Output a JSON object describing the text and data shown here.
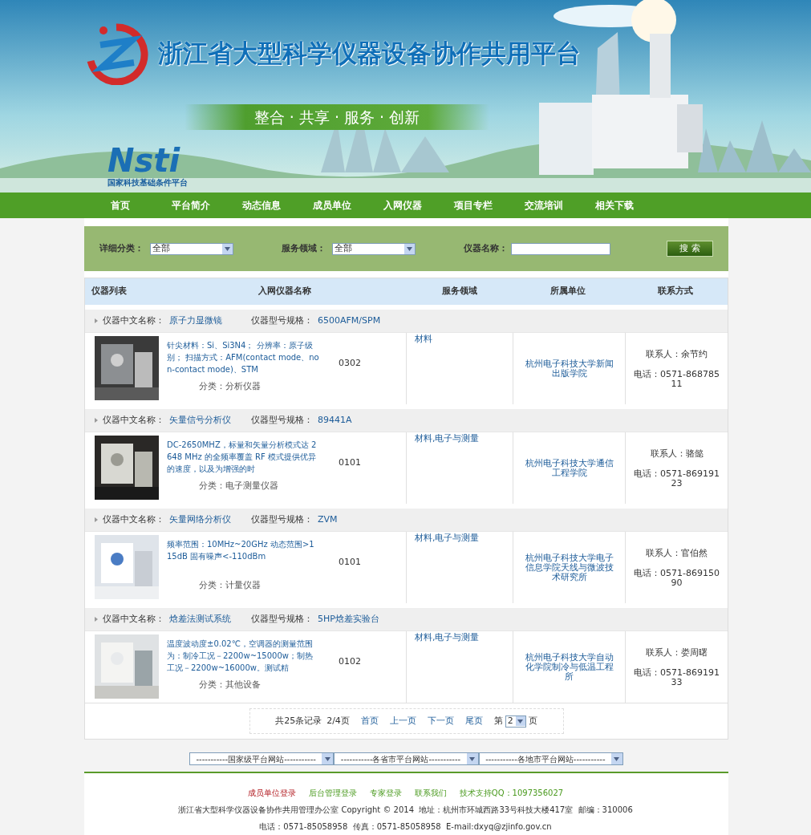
{
  "header": {
    "title": "浙江省大型科学仪器设备协作共用平台",
    "slogan": "整合 · 共享 · 服务 · 创新",
    "partner_mark": "Nsti",
    "partner_caption": "国家科技基础条件平台"
  },
  "nav": [
    "首页",
    "平台简介",
    "动态信息",
    "成员单位",
    "入网仪器",
    "项目专栏",
    "交流培训",
    "相关下载"
  ],
  "filters": [
    {
      "kind": "select",
      "label": "详细分类：",
      "value": "全部"
    },
    {
      "kind": "select",
      "label": "服务领域：",
      "value": "全部"
    },
    {
      "kind": "text",
      "label": "仪器名称："
    }
  ],
  "search_button": "搜 索",
  "table": {
    "columns": [
      "仪器列表",
      "入网仪器名称",
      "服务领域",
      "所属单位",
      "联系方式"
    ],
    "items": [
      {
        "name_label": "仪器中文名称：",
        "name": "原子力显微镜",
        "model_label": "仪器型号规格：",
        "model": "6500AFM/SPM",
        "description": "针尖材料：Si、Si3N4； 分辨率：原子级别； 扫描方式：AFM(contact mode、non-contact mode)、STM",
        "code": "0302",
        "category": "分类：分析仪器",
        "service": "材料",
        "unit": "杭州电子科技大学新闻出版学院",
        "contact": "联系人：余节约",
        "phone": "电话：0571-86878511"
      },
      {
        "name_label": "仪器中文名称：",
        "name": "矢量信号分析仪",
        "model_label": "仪器型号规格：",
        "model": "89441A",
        "description": "DC-2650MHZ，标量和矢量分析模式达 2648 MHz 的全频率覆盖 RF 模式提供优异的速度，以及为增强的时",
        "code": "0101",
        "category": "分类：电子测量仪器",
        "service": "材料,电子与测量",
        "unit": "杭州电子科技大学通信工程学院",
        "contact": "联系人：骆懿",
        "phone": "电话：0571-86919123"
      },
      {
        "name_label": "仪器中文名称：",
        "name": "矢量网络分析仪",
        "model_label": "仪器型号规格：",
        "model": "ZVM",
        "description": "频率范围：10MHz~20GHz 动态范围>115dB 固有噪声<-110dBm",
        "code": "0101",
        "category": "分类：计量仪器",
        "service": "材料,电子与测量",
        "unit": "杭州电子科技大学电子信息学院天线与微波技术研究所",
        "contact": "联系人：官伯然",
        "phone": "电话：0571-86915090"
      },
      {
        "name_label": "仪器中文名称：",
        "name": "焓差法测试系统",
        "model_label": "仪器型号规格：",
        "model": "5HP焓差实验台",
        "description": "温度波动度±0.02℃，空调器的测量范围为：制冷工况－2200w~15000w；制热工况－2200w~16000w。测试精",
        "code": "0102",
        "category": "分类：其他设备",
        "service": "材料,电子与测量",
        "unit": "杭州电子科技大学自动化学院制冷与低温工程所",
        "contact": "联系人：娄周曙",
        "phone": "电话：0571-86919133"
      }
    ]
  },
  "pagination": {
    "summary": "共25条记录",
    "pages": "2/4页",
    "links": [
      "首页",
      "上一页",
      "下一页",
      "尾页"
    ],
    "page_prefix": "第",
    "page_value": "2",
    "page_suffix": "页"
  },
  "site_selects": [
    "-----------国家级平台网站-----------",
    "-----------各省市平台网站-----------",
    "-----------各地市平台网站-----------"
  ],
  "footer": {
    "links": [
      {
        "text": "成员单位登录",
        "kind": "primary"
      },
      {
        "text": "后台管理登录",
        "kind": "link"
      },
      {
        "text": "专家登录",
        "kind": "link"
      },
      {
        "text": "联系我们",
        "kind": "link"
      },
      {
        "text": "技术支持QQ：1097356027",
        "kind": "link"
      }
    ],
    "lines": [
      "浙江省大型科学仪器设备协作共用管理办公室 Copyright © 2014  地址：杭州市环城西路33号科技大楼417室  邮编：310006",
      "电话：0571-85058958  传真：0571-85058958  E-mail:dxyq@zjinfo.gov.cn"
    ]
  }
}
